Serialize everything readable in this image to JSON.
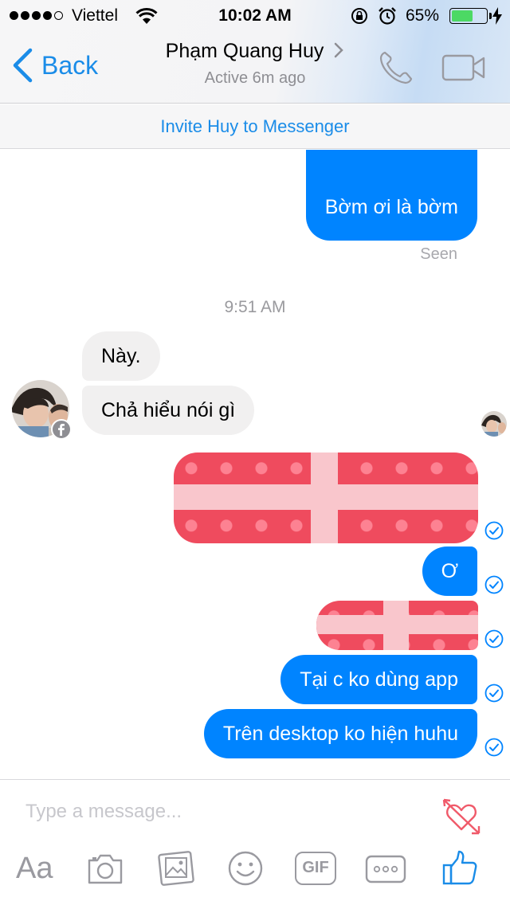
{
  "status_bar": {
    "carrier": "Viettel",
    "time": "10:02 AM",
    "battery_percent": "65%",
    "battery_level": 0.65
  },
  "header": {
    "back_label": "Back",
    "contact_name": "Phạm Quang Huy",
    "contact_status": "Active 6m ago"
  },
  "invite_banner": "Invite Huy to Messenger",
  "thread": {
    "outgoing_top": "Bờm ơi là bờm",
    "seen_label": "Seen",
    "timestamp": "9:51 AM",
    "incoming": [
      "Này.",
      "Chả hiểu nói gì"
    ],
    "outgoing_short": "Ơ",
    "outgoing_app": "Tại c ko dùng app",
    "outgoing_desktop": "Trên desktop ko hiện huhu"
  },
  "composer": {
    "placeholder": "Type a message...",
    "text_button": "Aa",
    "gif_label": "GIF"
  },
  "colors": {
    "accent": "#1a8ce8",
    "outgoing_bubble": "#0084ff",
    "incoming_bubble": "#f1f0f0",
    "gift_red": "#ef4b5e"
  }
}
